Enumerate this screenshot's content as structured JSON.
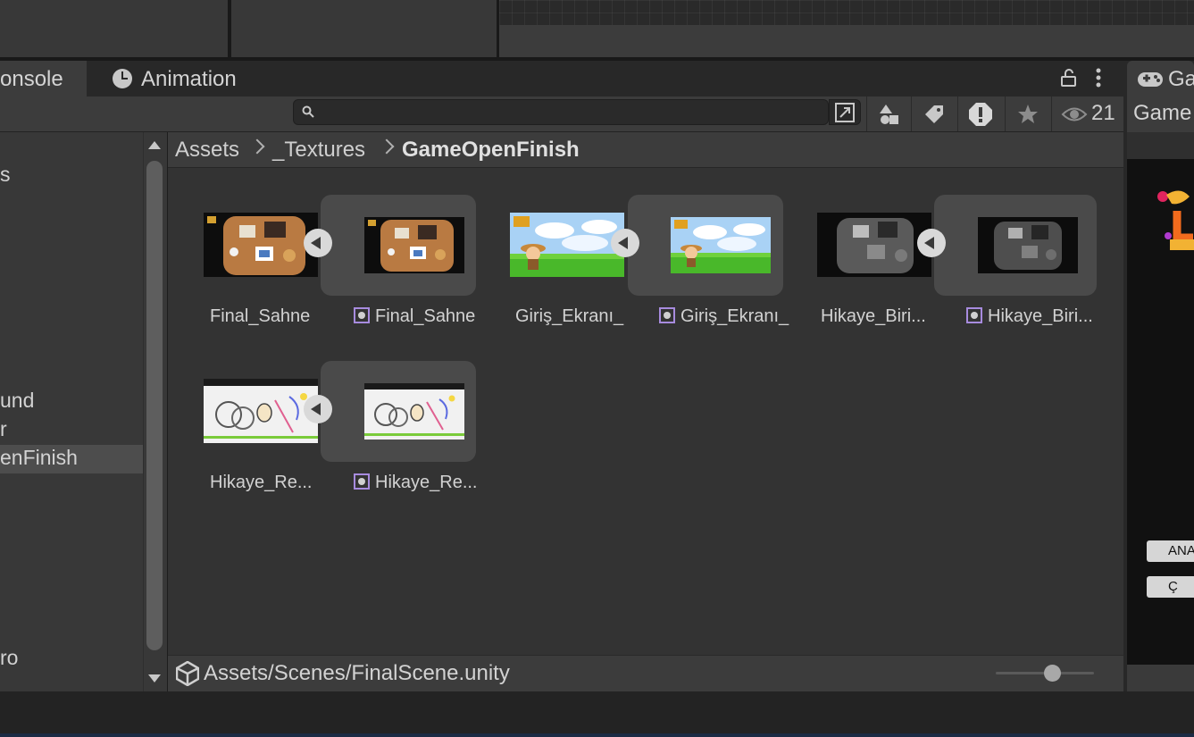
{
  "tabs": {
    "console_label": "onsole",
    "animation_label": "Animation",
    "game_tab_label": "Ga"
  },
  "toolbar": {
    "search_placeholder": "",
    "hidden_count": "21"
  },
  "tree": {
    "items": [
      {
        "label": "s"
      },
      {
        "label": "und"
      },
      {
        "label": "r"
      },
      {
        "label": "enFinish",
        "selected": true
      },
      {
        "label": "ro"
      }
    ]
  },
  "breadcrumb": {
    "items": [
      "Assets",
      "_Textures",
      "GameOpenFinish"
    ]
  },
  "assets": [
    {
      "label": "Final_Sahne",
      "sprite_label": "Final_Sahne"
    },
    {
      "label": "Giriş_Ekranı_",
      "sprite_label": "Giriş_Ekranı_"
    },
    {
      "label": "Hikaye_Biri...",
      "sprite_label": "Hikaye_Biri..."
    },
    {
      "label": "Hikaye_Re...",
      "sprite_label": "Hikaye_Re..."
    }
  ],
  "status": {
    "path": "Assets/Scenes/FinalScene.unity",
    "zoom_fraction": 0.58
  },
  "right_panel": {
    "game_label": "Game",
    "button1_label": "ANA",
    "button2_label": "Ç"
  },
  "colors": {
    "sprite_icon": "#a78bde",
    "selection": "#4d4d4d",
    "panel": "#383838"
  }
}
